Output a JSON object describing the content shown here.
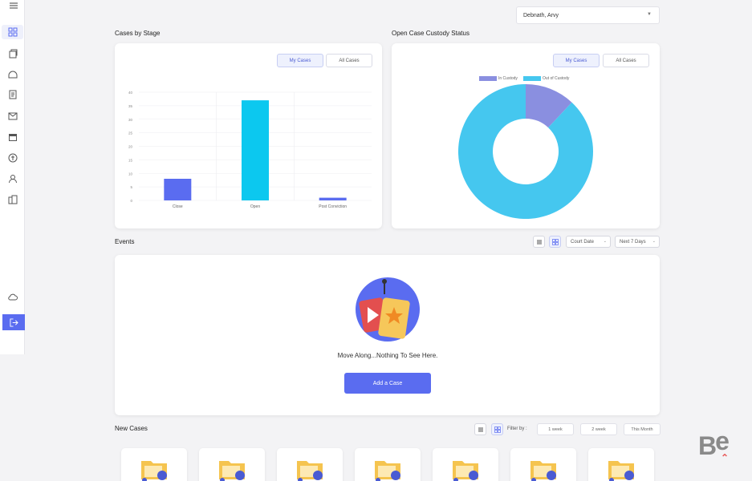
{
  "header": {
    "user_select_value": "Debnath, Arvy"
  },
  "cases_by_stage": {
    "title": "Cases by Stage",
    "toggle_my": "My Cases",
    "toggle_all": "All Cases"
  },
  "custody": {
    "title": "Open Case Custody Status",
    "toggle_my": "My Cases",
    "toggle_all": "All Cases",
    "legend": [
      "In Custody",
      "Out of Custody"
    ]
  },
  "events": {
    "title": "Events",
    "date_filter": "Court Date",
    "range_filter": "Next 7 Days",
    "empty_message": "Move Along...Nothing To See Here.",
    "add_button": "Add a Case"
  },
  "new_cases": {
    "title": "New Cases",
    "filter_label": "Filter by :",
    "filters": [
      "1 week",
      "2 week",
      "This Month"
    ]
  },
  "colors": {
    "accent": "#5a6cf0",
    "bar_primary": "#5a6cf0",
    "bar_cyan": "#0cc8ef",
    "donut_in": "#8a8fe0",
    "donut_out": "#45c7ef"
  },
  "chart_data": [
    {
      "type": "bar",
      "categories": [
        "Close",
        "Open",
        "Post Conviction"
      ],
      "values": [
        8,
        37,
        1
      ],
      "colors": [
        "#5a6cf0",
        "#0cc8ef",
        "#5a6cf0"
      ],
      "yticks": [
        0,
        5,
        10,
        15,
        20,
        25,
        30,
        35,
        40
      ],
      "ylim": [
        0,
        40
      ],
      "grid": true
    },
    {
      "type": "pie",
      "donut": true,
      "labels": [
        "In Custody",
        "Out of Custody"
      ],
      "values": [
        12,
        88
      ],
      "colors": [
        "#8a8fe0",
        "#45c7ef"
      ],
      "legend": "top"
    }
  ]
}
